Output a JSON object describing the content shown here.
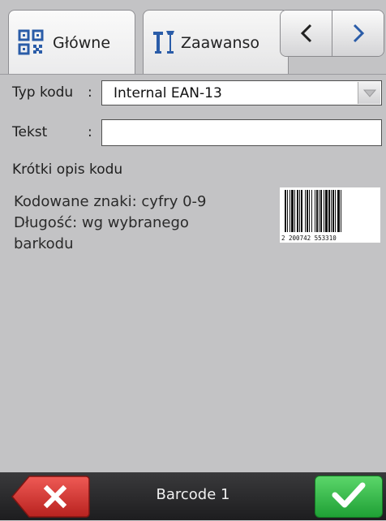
{
  "tabs": [
    {
      "label": "Główne",
      "icon": "qr-code-icon",
      "active": true
    },
    {
      "label": "Zaawanso",
      "icon": "tools-icon",
      "active": false
    }
  ],
  "nav": {
    "prev_icon": "chevron-left-icon",
    "next_icon": "chevron-right-icon"
  },
  "form": {
    "code_type_label": "Typ kodu",
    "code_type_colon": ":",
    "code_type_value": "Internal EAN-13",
    "text_label": "Tekst",
    "text_colon": ":",
    "text_value": ""
  },
  "description": {
    "heading": "Krótki opis kodu",
    "line1": "Kodowane znaki: cyfry 0-9",
    "line2": "Długość: wg wybranego barkodu"
  },
  "barcode_preview": {
    "digits": "2 200742 553310"
  },
  "bottom": {
    "title": "Barcode 1",
    "cancel_icon": "close-icon",
    "ok_icon": "checkmark-icon",
    "cancel_color": "#d93a36",
    "ok_color": "#3cbf4e"
  }
}
